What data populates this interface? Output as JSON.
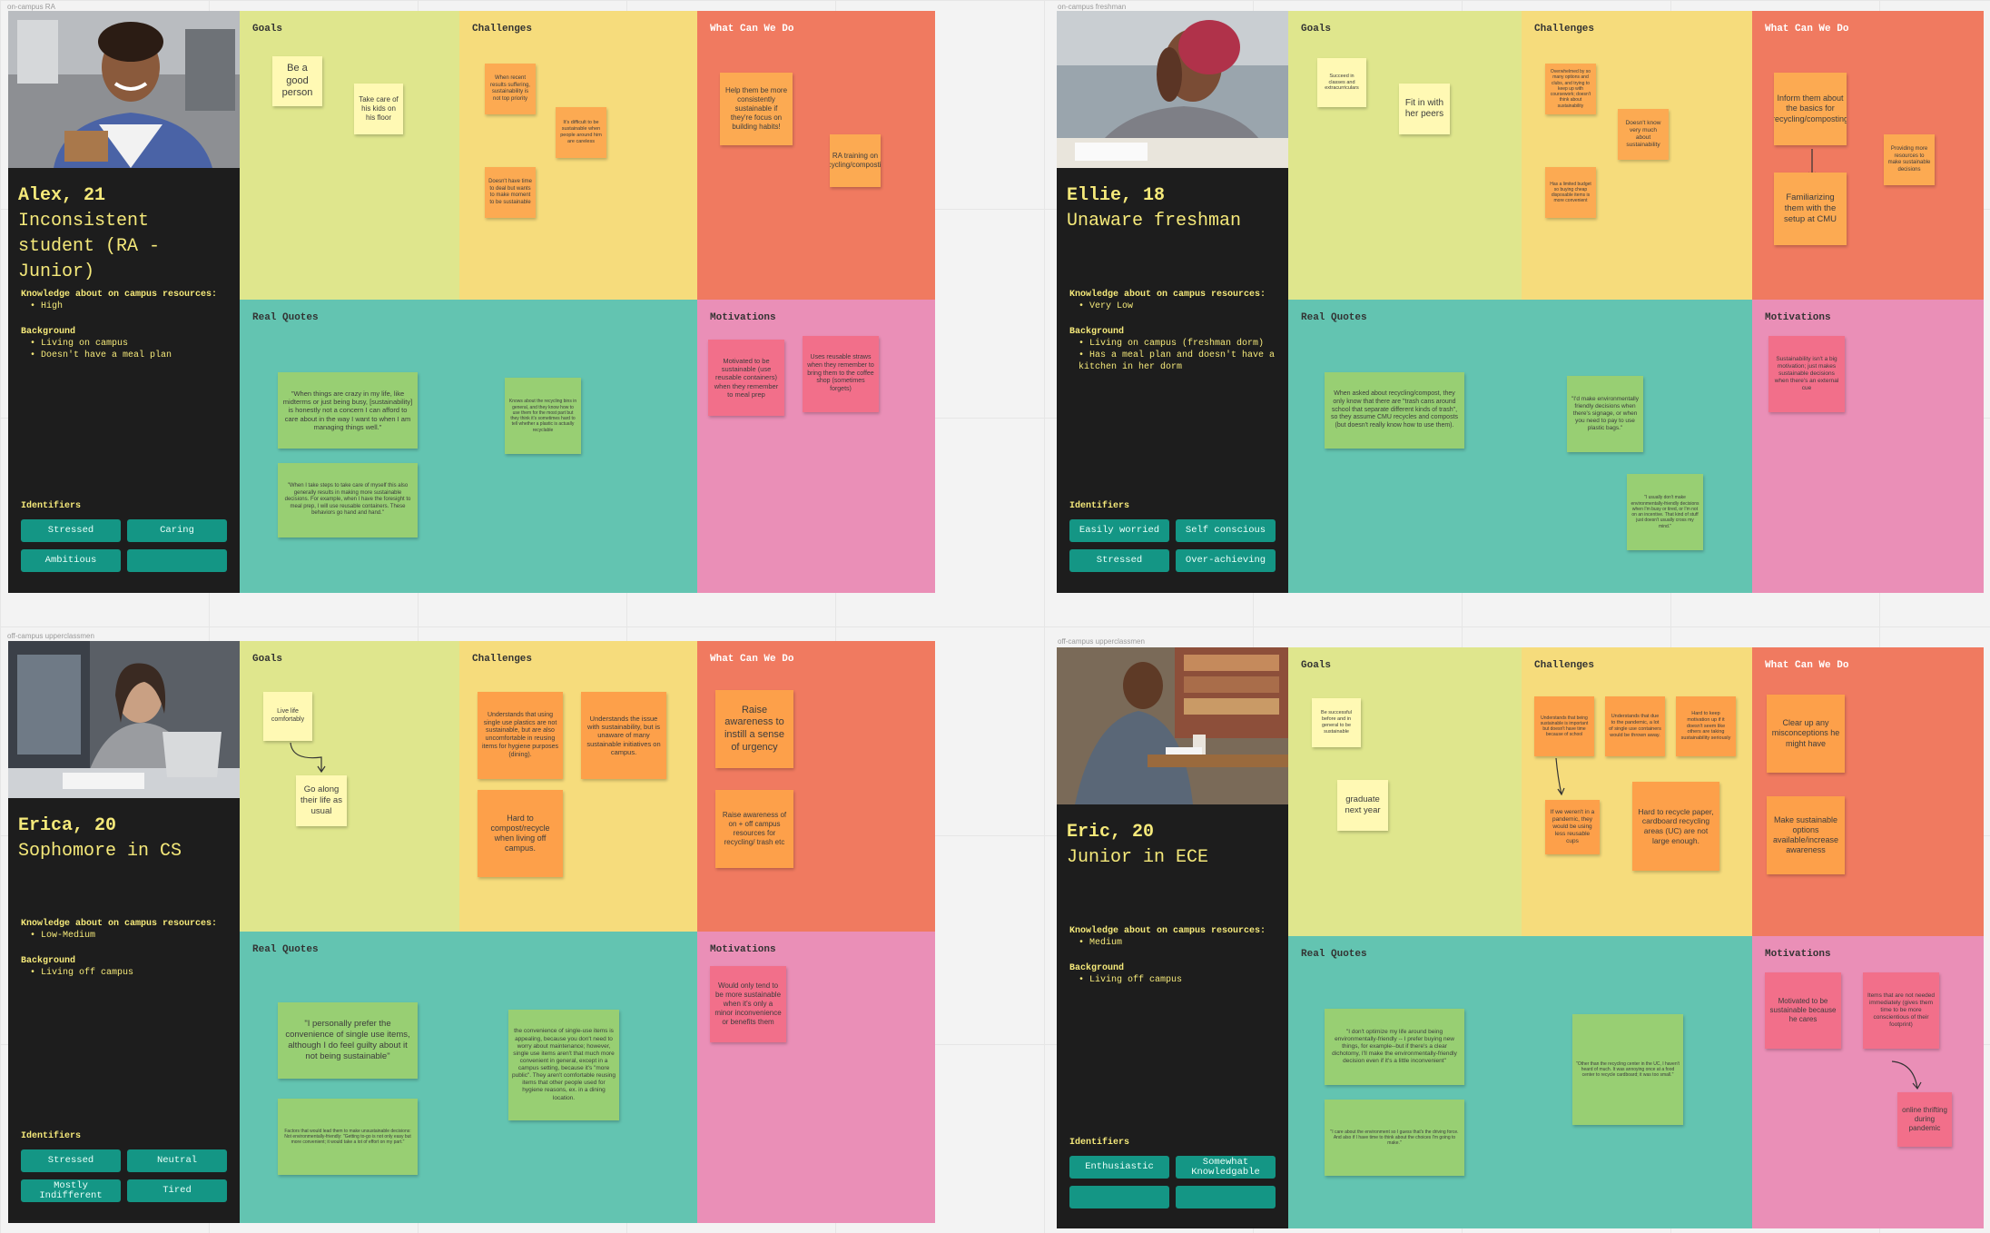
{
  "labels": {
    "goals": "Goals",
    "challenges": "Challenges",
    "what": "What Can We Do",
    "quotes": "Real Quotes",
    "motivations": "Motivations",
    "identifiers": "Identifiers",
    "knowledge": "Knowledge about on campus resources:",
    "background": "Background"
  },
  "frames": [
    "on-campus RA",
    "on-campus freshman",
    "off-campus upperclassmen",
    "off-campus upperclassmen"
  ],
  "personas": [
    {
      "name": "Alex, 21",
      "role": "Inconsistent student (RA - Junior)",
      "knowledge": [
        "High"
      ],
      "background": [
        "Living on campus",
        "Doesn't have a meal plan"
      ],
      "identifiers": [
        "Stressed",
        "Caring",
        "Ambitious",
        ""
      ],
      "goals": [
        "Be a good person",
        "Take care of his kids on his floor"
      ],
      "challenges": [
        "When recent results suffering, sustainability is not top priority",
        "It's difficult to be sustainable when people around him are careless",
        "Doesn't have time to deal but wants to make moment to be sustainable"
      ],
      "what": [
        "Help them be more consistently sustainable if they're focus on building habits!",
        "RA training on recycling/composting"
      ],
      "quotes": [
        "\"When things are crazy in my life, like midterms or just being busy, [sustainability] is honestly not a concern I can afford to care about in the way I want to when I am managing things well.\"",
        "\"When I take steps to take care of myself this also generally results in making more sustainable decisions. For example, when I have the foresight to meal prep, I will use reusable containers. These behaviors go hand and hand.\""
      ],
      "quotes2": [
        "Knows about the recycling bins in general, and they know how to use them for the most part but they think it's sometimes hard to tell whether a plastic is actually recyclable"
      ],
      "motivations": [
        "Motivated to be sustainable (use reusable containers) when they remember to meal prep",
        "Uses reusable straws when they remember to bring them to the coffee shop (sometimes forgets)"
      ]
    },
    {
      "name": "Ellie, 18",
      "role": "Unaware freshman",
      "knowledge": [
        "Very Low"
      ],
      "background": [
        "Living on campus (freshman dorm)",
        "Has a meal plan and doesn't have a kitchen in her dorm"
      ],
      "identifiers": [
        "Easily worried",
        "Self conscious",
        "Stressed",
        "Over-achieving"
      ],
      "goals": [
        "Succeed in classes and extracurriculars",
        "Fit in with her peers"
      ],
      "challenges": [
        "Overwhelmed by so many options and clubs, and trying to keep up with coursework; doesn't think about sustainability",
        "Doesn't know very much about sustainability",
        "Has a limited budget so buying cheap disposable items is more convenient"
      ],
      "what": [
        "Inform them about the basics for recycling/composting",
        "Familiarizing them with the setup at CMU",
        "Providing more resources to make sustainable decisions"
      ],
      "quotes": [
        "When asked about recycling/compost, they only know that there are \"trash cans around school that separate different kinds of trash\", so they assume CMU recycles and composts (but doesn't really know how to use them)."
      ],
      "quotes2": [
        "\"I'd make environmentally friendly decisions when there's signage, or when you need to pay to use plastic bags.\"",
        "\"I usually don't make environmentally-friendly decisions when I'm busy or tired, or I'm not on an incentive. That kind of stuff just doesn't usually cross my mind.\""
      ],
      "motivations": [
        "Sustainability isn't a big motivation; just makes sustainable decisions when there's an external cue"
      ]
    },
    {
      "name": "Erica, 20",
      "role": "Sophomore in CS",
      "knowledge": [
        "Low-Medium"
      ],
      "background": [
        "Living off campus"
      ],
      "identifiers": [
        "Stressed",
        "Neutral",
        "Mostly Indifferent",
        "Tired"
      ],
      "goals": [
        "Live life comfortably",
        "Go along their life as usual"
      ],
      "challenges": [
        "Understands that using single use plastics are not sustainable, but are also uncomfortable in reusing items for hygiene purposes (dining).",
        "Understands the issue with sustainability, but is unaware of many sustainable initiatives on campus.",
        "Hard to compost/recycle when living off campus."
      ],
      "what": [
        "Raise awareness to instill a sense of urgency",
        "Raise awareness of on + off campus resources for recycling/ trash etc"
      ],
      "quotes": [
        "\"I personally prefer the convenience of single use items, although I do feel guilty about it not being sustainable\"",
        "Factors that would lead them to make unsustainable decisions: Not environmentally-friendly: \"Getting to-go is not only easy but more convenient; it would take a lot of effort on my part.\""
      ],
      "quotes2": [
        "the convenience of single-use items is appealing, because you don't need to worry about maintenance; however, single use items aren't that much more convenient in general, except in a campus setting, because it's \"more public\". They aren't comfortable reusing items that other people used for hygiene reasons, ex. in a dining location."
      ],
      "motivations": [
        "Would only tend to be more sustainable when it's only a minor inconvenience or benefits them"
      ]
    },
    {
      "name": "Eric, 20",
      "role": "Junior in ECE",
      "knowledge": [
        "Medium"
      ],
      "background": [
        "Living off campus"
      ],
      "identifiers": [
        "Enthusiastic",
        "Somewhat Knowledgable",
        "",
        ""
      ],
      "goals": [
        "Be successful before and in general to be sustainable",
        "graduate next year"
      ],
      "challenges": [
        "Understands that being sustainable is important but doesn't have time because of school",
        "Understands that due to the pandemic, a lot of single use containers would be thrown away.",
        "Hard to keep motivation up if it doesn't seem like others are taking sustainability seriously",
        "If we weren't in a pandemic, they would be using less reusable cups",
        "Hard to recycle paper, cardboard recycling areas (UC) are not large enough."
      ],
      "what": [
        "Clear up any misconceptions he might have",
        "Make sustainable options available/increase awareness"
      ],
      "quotes": [
        "\"I don't optimize my life around being environmentally-friendly -- I prefer buying new things, for example--but if there's a clear dichotomy, I'll make the environmentally-friendly decision even if it's a little inconvenient\"",
        "\"I care about the environment so I guess that's the driving force. And also if I have time to think about the choices I'm going to make.\""
      ],
      "quotes2": [
        "\"Other than the recycling center in the UC, I haven't heard of much. It was annoying once at a food center to recycle cardboard; it was too small.\""
      ],
      "motivations": [
        "Motivated to be sustainable because he cares",
        "Items that are not needed immediately (gives them time to be more conscientious of their footprint)",
        "online thrifting during pandemic"
      ]
    }
  ]
}
